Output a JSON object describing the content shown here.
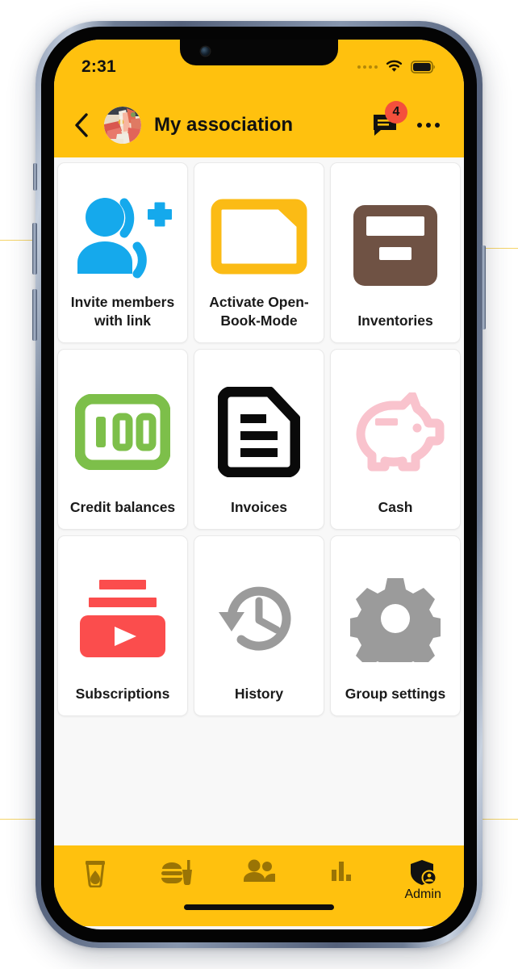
{
  "theme": {
    "brand_yellow": "#FFC10E",
    "badge_red": "#F4503C",
    "screen_bg": "#F8F8F8",
    "card_bg": "#FFFFFF",
    "nav_icon_inactive": "#9A7405",
    "nav_icon_active": "#111111"
  },
  "status_bar": {
    "time": "2:31",
    "signal_icon": "signal-dots-icon",
    "wifi_icon": "wifi-icon",
    "battery_icon": "battery-full-icon"
  },
  "app_bar": {
    "back_icon": "chevron-left-icon",
    "avatar_icon": "group-avatar-image",
    "title": "My association",
    "chat_icon": "chat-bubble-icon",
    "chat_badge_count": "4",
    "more_icon": "more-horizontal-icon"
  },
  "grid": {
    "tiles": [
      {
        "label": "Invite members with link",
        "icon": "person-add-invite-icon",
        "color": "#15A9EC"
      },
      {
        "label": "Activate Open-Book-Mode",
        "icon": "folder-open-book-icon",
        "color": "#FBBB15"
      },
      {
        "label": "Inventories",
        "icon": "archive-box-icon",
        "color": "#6F5244"
      },
      {
        "label": "Credit balances",
        "icon": "banknote-100-icon",
        "color": "#7DBF4A"
      },
      {
        "label": "Invoices",
        "icon": "document-lines-icon",
        "color": "#0A0A0A"
      },
      {
        "label": "Cash",
        "icon": "piggy-bank-icon",
        "color": "#F9C3CD"
      },
      {
        "label": "Subscriptions",
        "icon": "subscriptions-play-icon",
        "color": "#FB4D4D"
      },
      {
        "label": "History",
        "icon": "history-clock-icon",
        "color": "#9B9B9B"
      },
      {
        "label": "Group settings",
        "icon": "gear-settings-icon",
        "color": "#9B9B9B"
      }
    ]
  },
  "bottom_nav": {
    "items": [
      {
        "label": "",
        "icon": "drink-cup-icon",
        "active": false
      },
      {
        "label": "",
        "icon": "food-meal-icon",
        "active": false
      },
      {
        "label": "",
        "icon": "people-group-icon",
        "active": false
      },
      {
        "label": "",
        "icon": "bar-chart-icon",
        "active": false
      },
      {
        "label": "Admin",
        "icon": "shield-admin-icon",
        "active": true
      }
    ]
  }
}
